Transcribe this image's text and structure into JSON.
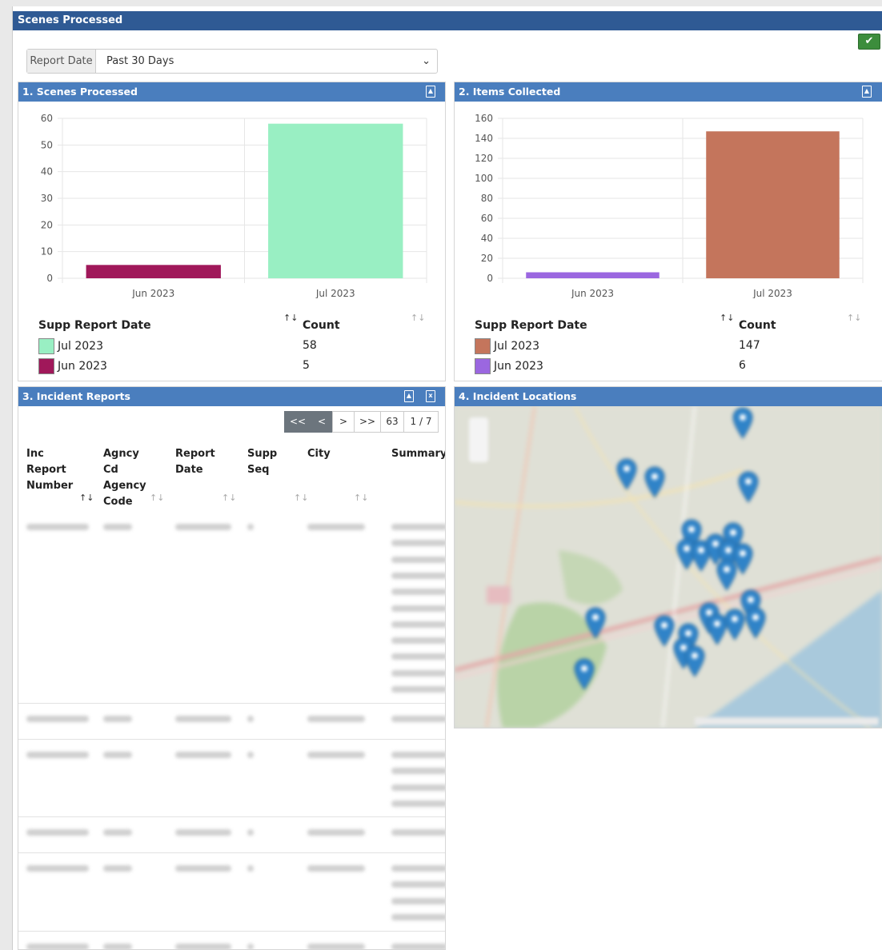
{
  "header": {
    "title": "Scenes Processed"
  },
  "filter": {
    "label": "Report Date",
    "value": "Past 30 Days"
  },
  "panels": {
    "scenes": {
      "title": "1. Scenes Processed",
      "legend_header_date": "Supp Report Date",
      "legend_header_count": "Count",
      "legend_rows": [
        {
          "label": "Jul 2023",
          "count": "58",
          "color": "#99efc3"
        },
        {
          "label": "Jun 2023",
          "count": "5",
          "color": "#a0185a"
        }
      ]
    },
    "items": {
      "title": "2. Items Collected",
      "legend_header_date": "Supp Report Date",
      "legend_header_count": "Count",
      "legend_rows": [
        {
          "label": "Jul 2023",
          "count": "147",
          "color": "#c4755c"
        },
        {
          "label": "Jun 2023",
          "count": "6",
          "color": "#9b67e0"
        }
      ]
    },
    "incidents": {
      "title": "3. Incident Reports",
      "pager": {
        "first": "<<",
        "prev": "<",
        "next": ">",
        "last": ">>",
        "total": "63",
        "page": "1 / 7"
      },
      "columns": [
        {
          "lines": [
            "Inc",
            "Report",
            "Number"
          ]
        },
        {
          "lines": [
            "Agncy",
            "Cd",
            "Agency",
            "Code"
          ]
        },
        {
          "lines": [
            "Report",
            "Date"
          ]
        },
        {
          "lines": [
            "Supp",
            "Seq"
          ]
        },
        {
          "lines": [
            "City"
          ]
        },
        {
          "lines": [
            "Summary"
          ]
        }
      ]
    },
    "locations": {
      "title": "4. Incident Locations"
    }
  },
  "chart_data": [
    {
      "type": "bar",
      "categories": [
        "Jun 2023",
        "Jul 2023"
      ],
      "values": [
        5,
        58
      ],
      "colors": [
        "#a0185a",
        "#99efc3"
      ],
      "ylim": [
        0,
        60
      ],
      "yticks": [
        0,
        10,
        20,
        30,
        40,
        50,
        60
      ],
      "grid": true
    },
    {
      "type": "bar",
      "categories": [
        "Jun 2023",
        "Jul 2023"
      ],
      "values": [
        6,
        147
      ],
      "colors": [
        "#9b67e0",
        "#c4755c"
      ],
      "ylim": [
        0,
        160
      ],
      "yticks": [
        0,
        20,
        40,
        60,
        80,
        100,
        120,
        140,
        160
      ],
      "grid": true
    }
  ]
}
